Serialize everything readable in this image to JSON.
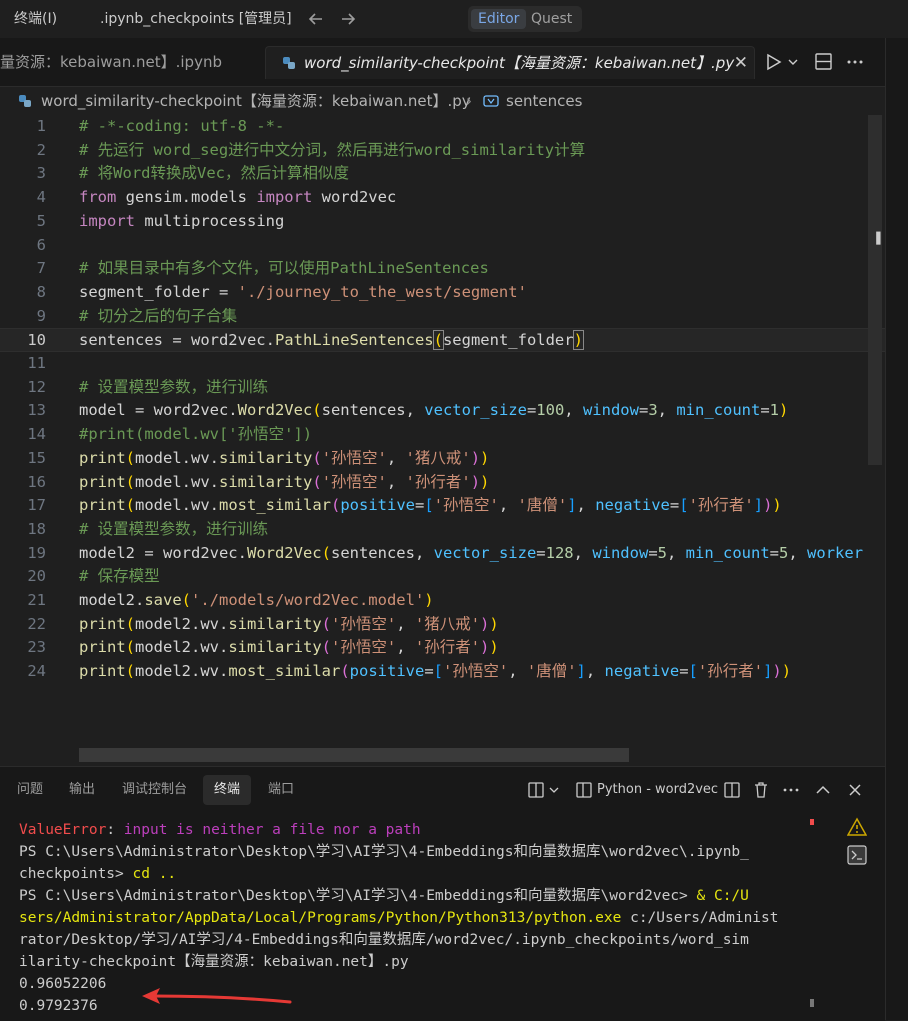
{
  "titlebar": {
    "panel_title": "终端(I)",
    "folder_title": ".ipynb_checkpoints [管理员]",
    "mode_editor": "Editor",
    "mode_quest": "Quest"
  },
  "tabs": {
    "inactive_label": "量资源：kebaiwan.net】.ipynb",
    "active_label": "word_similarity-checkpoint【海量资源：kebaiwan.net】.py",
    "close_glyph": "✕"
  },
  "breadcrumb": {
    "file": "word_similarity-checkpoint【海量资源：kebaiwan.net】.py",
    "separator": "›",
    "symbol": "sentences"
  },
  "editor": {
    "current_line": 10,
    "lines": [
      {
        "n": "1",
        "tokens": [
          {
            "t": "# -*-coding: utf-8 -*-",
            "c": "cm"
          }
        ]
      },
      {
        "n": "2",
        "tokens": [
          {
            "t": "# 先运行 word_seg进行中文分词，然后再进行word_similarity计算",
            "c": "cm"
          }
        ]
      },
      {
        "n": "3",
        "tokens": [
          {
            "t": "# 将Word转换成Vec，然后计算相似度",
            "c": "cm"
          }
        ]
      },
      {
        "n": "4",
        "tokens": [
          {
            "t": "from",
            "c": "kw"
          },
          {
            "t": " gensim.models ",
            "c": "id"
          },
          {
            "t": "import",
            "c": "kw"
          },
          {
            "t": " word2vec",
            "c": "id"
          }
        ]
      },
      {
        "n": "5",
        "tokens": [
          {
            "t": "import",
            "c": "kw"
          },
          {
            "t": " multiprocessing",
            "c": "id"
          }
        ]
      },
      {
        "n": "6",
        "tokens": []
      },
      {
        "n": "7",
        "tokens": [
          {
            "t": "# 如果目录中有多个文件，可以使用PathLineSentences",
            "c": "cm"
          }
        ]
      },
      {
        "n": "8",
        "tokens": [
          {
            "t": "segment_folder = ",
            "c": "id"
          },
          {
            "t": "'./journey_to_the_west/segment'",
            "c": "str"
          }
        ]
      },
      {
        "n": "9",
        "tokens": [
          {
            "t": "# 切分之后的句子合集",
            "c": "cm"
          }
        ]
      },
      {
        "n": "10",
        "tokens": [
          {
            "t": "sentences = word2vec.",
            "c": "id"
          },
          {
            "t": "PathLineSentences",
            "c": "fn"
          },
          {
            "t": "(",
            "c": "br1 br-hl"
          },
          {
            "t": "segment_folder",
            "c": "id"
          },
          {
            "t": ")",
            "c": "br1 br-hl"
          }
        ]
      },
      {
        "n": "11",
        "tokens": []
      },
      {
        "n": "12",
        "tokens": [
          {
            "t": "# 设置模型参数，进行训练",
            "c": "cm"
          }
        ]
      },
      {
        "n": "13",
        "tokens": [
          {
            "t": "model = word2vec.",
            "c": "id"
          },
          {
            "t": "Word2Vec",
            "c": "fn"
          },
          {
            "t": "(",
            "c": "br1"
          },
          {
            "t": "sentences, ",
            "c": "id"
          },
          {
            "t": "vector_size",
            "c": "prm"
          },
          {
            "t": "=",
            "c": "id"
          },
          {
            "t": "100",
            "c": "num"
          },
          {
            "t": ", ",
            "c": "id"
          },
          {
            "t": "window",
            "c": "prm"
          },
          {
            "t": "=",
            "c": "id"
          },
          {
            "t": "3",
            "c": "num"
          },
          {
            "t": ", ",
            "c": "id"
          },
          {
            "t": "min_count",
            "c": "prm"
          },
          {
            "t": "=",
            "c": "id"
          },
          {
            "t": "1",
            "c": "num"
          },
          {
            "t": ")",
            "c": "br1"
          }
        ]
      },
      {
        "n": "14",
        "tokens": [
          {
            "t": "#print(model.wv['孙悟空'])",
            "c": "cm"
          }
        ]
      },
      {
        "n": "15",
        "tokens": [
          {
            "t": "print",
            "c": "fn"
          },
          {
            "t": "(",
            "c": "br1"
          },
          {
            "t": "model.wv.",
            "c": "id"
          },
          {
            "t": "similarity",
            "c": "fn"
          },
          {
            "t": "(",
            "c": "br2"
          },
          {
            "t": "'孙悟空'",
            "c": "str"
          },
          {
            "t": ", ",
            "c": "id"
          },
          {
            "t": "'猪八戒'",
            "c": "str"
          },
          {
            "t": ")",
            "c": "br2"
          },
          {
            "t": ")",
            "c": "br1"
          }
        ]
      },
      {
        "n": "16",
        "tokens": [
          {
            "t": "print",
            "c": "fn"
          },
          {
            "t": "(",
            "c": "br1"
          },
          {
            "t": "model.wv.",
            "c": "id"
          },
          {
            "t": "similarity",
            "c": "fn"
          },
          {
            "t": "(",
            "c": "br2"
          },
          {
            "t": "'孙悟空'",
            "c": "str"
          },
          {
            "t": ", ",
            "c": "id"
          },
          {
            "t": "'孙行者'",
            "c": "str"
          },
          {
            "t": ")",
            "c": "br2"
          },
          {
            "t": ")",
            "c": "br1"
          }
        ]
      },
      {
        "n": "17",
        "tokens": [
          {
            "t": "print",
            "c": "fn"
          },
          {
            "t": "(",
            "c": "br1"
          },
          {
            "t": "model.wv.",
            "c": "id"
          },
          {
            "t": "most_similar",
            "c": "fn"
          },
          {
            "t": "(",
            "c": "br2"
          },
          {
            "t": "positive",
            "c": "prm"
          },
          {
            "t": "=",
            "c": "id"
          },
          {
            "t": "[",
            "c": "br3"
          },
          {
            "t": "'孙悟空'",
            "c": "str"
          },
          {
            "t": ", ",
            "c": "id"
          },
          {
            "t": "'唐僧'",
            "c": "str"
          },
          {
            "t": "]",
            "c": "br3"
          },
          {
            "t": ", ",
            "c": "id"
          },
          {
            "t": "negative",
            "c": "prm"
          },
          {
            "t": "=",
            "c": "id"
          },
          {
            "t": "[",
            "c": "br3"
          },
          {
            "t": "'孙行者'",
            "c": "str"
          },
          {
            "t": "]",
            "c": "br3"
          },
          {
            "t": ")",
            "c": "br2"
          },
          {
            "t": ")",
            "c": "br1"
          }
        ]
      },
      {
        "n": "18",
        "tokens": [
          {
            "t": "# 设置模型参数，进行训练",
            "c": "cm"
          }
        ]
      },
      {
        "n": "19",
        "tokens": [
          {
            "t": "model2 = word2vec.",
            "c": "id"
          },
          {
            "t": "Word2Vec",
            "c": "fn"
          },
          {
            "t": "(",
            "c": "br1"
          },
          {
            "t": "sentences, ",
            "c": "id"
          },
          {
            "t": "vector_size",
            "c": "prm"
          },
          {
            "t": "=",
            "c": "id"
          },
          {
            "t": "128",
            "c": "num"
          },
          {
            "t": ", ",
            "c": "id"
          },
          {
            "t": "window",
            "c": "prm"
          },
          {
            "t": "=",
            "c": "id"
          },
          {
            "t": "5",
            "c": "num"
          },
          {
            "t": ", ",
            "c": "id"
          },
          {
            "t": "min_count",
            "c": "prm"
          },
          {
            "t": "=",
            "c": "id"
          },
          {
            "t": "5",
            "c": "num"
          },
          {
            "t": ", ",
            "c": "id"
          },
          {
            "t": "worker",
            "c": "prm"
          }
        ]
      },
      {
        "n": "20",
        "tokens": [
          {
            "t": "# 保存模型",
            "c": "cm"
          }
        ]
      },
      {
        "n": "21",
        "tokens": [
          {
            "t": "model2.",
            "c": "id"
          },
          {
            "t": "save",
            "c": "fn"
          },
          {
            "t": "(",
            "c": "br1"
          },
          {
            "t": "'./models/word2Vec.model'",
            "c": "str"
          },
          {
            "t": ")",
            "c": "br1"
          }
        ]
      },
      {
        "n": "22",
        "tokens": [
          {
            "t": "print",
            "c": "fn"
          },
          {
            "t": "(",
            "c": "br1"
          },
          {
            "t": "model2.wv.",
            "c": "id"
          },
          {
            "t": "similarity",
            "c": "fn"
          },
          {
            "t": "(",
            "c": "br2"
          },
          {
            "t": "'孙悟空'",
            "c": "str"
          },
          {
            "t": ", ",
            "c": "id"
          },
          {
            "t": "'猪八戒'",
            "c": "str"
          },
          {
            "t": ")",
            "c": "br2"
          },
          {
            "t": ")",
            "c": "br1"
          }
        ]
      },
      {
        "n": "23",
        "tokens": [
          {
            "t": "print",
            "c": "fn"
          },
          {
            "t": "(",
            "c": "br1"
          },
          {
            "t": "model2.wv.",
            "c": "id"
          },
          {
            "t": "similarity",
            "c": "fn"
          },
          {
            "t": "(",
            "c": "br2"
          },
          {
            "t": "'孙悟空'",
            "c": "str"
          },
          {
            "t": ", ",
            "c": "id"
          },
          {
            "t": "'孙行者'",
            "c": "str"
          },
          {
            "t": ")",
            "c": "br2"
          },
          {
            "t": ")",
            "c": "br1"
          }
        ]
      },
      {
        "n": "24",
        "tokens": [
          {
            "t": "print",
            "c": "fn"
          },
          {
            "t": "(",
            "c": "br1"
          },
          {
            "t": "model2.wv.",
            "c": "id"
          },
          {
            "t": "most_similar",
            "c": "fn"
          },
          {
            "t": "(",
            "c": "br2"
          },
          {
            "t": "positive",
            "c": "prm"
          },
          {
            "t": "=",
            "c": "id"
          },
          {
            "t": "[",
            "c": "br3"
          },
          {
            "t": "'孙悟空'",
            "c": "str"
          },
          {
            "t": ", ",
            "c": "id"
          },
          {
            "t": "'唐僧'",
            "c": "str"
          },
          {
            "t": "]",
            "c": "br3"
          },
          {
            "t": ", ",
            "c": "id"
          },
          {
            "t": "negative",
            "c": "prm"
          },
          {
            "t": "=",
            "c": "id"
          },
          {
            "t": "[",
            "c": "br3"
          },
          {
            "t": "'孙行者'",
            "c": "str"
          },
          {
            "t": "]",
            "c": "br3"
          },
          {
            "t": ")",
            "c": "br2"
          },
          {
            "t": ")",
            "c": "br1"
          }
        ]
      }
    ]
  },
  "panel": {
    "tabs": [
      "问题",
      "输出",
      "调试控制台",
      "终端",
      "端口"
    ],
    "active_tab": "终端",
    "terminal_name": "Python - word2vec"
  },
  "terminal": {
    "lines": [
      [
        {
          "t": "ValueError",
          "c": "err"
        },
        {
          "t": ": ",
          "c": ""
        },
        {
          "t": "input is neither a file nor a path",
          "c": "pink"
        }
      ],
      [
        {
          "t": "PS C:\\Users\\Administrator\\Desktop\\学习\\AI学习\\4-Embeddings和向量数据库\\word2vec\\.ipynb_",
          "c": ""
        }
      ],
      [
        {
          "t": "checkpoints> ",
          "c": ""
        },
        {
          "t": "cd ..",
          "c": "yel"
        }
      ],
      [
        {
          "t": "PS C:\\Users\\Administrator\\Desktop\\学习\\AI学习\\4-Embeddings和向量数据库\\word2vec> ",
          "c": ""
        },
        {
          "t": "& C:/U",
          "c": "yel"
        }
      ],
      [
        {
          "t": "sers/Administrator/AppData/Local/Programs/Python/Python313/python.exe",
          "c": "yel"
        },
        {
          "t": " c:/Users/Administ",
          "c": ""
        }
      ],
      [
        {
          "t": "rator/Desktop/学习/AI学习/4-Embeddings和向量数据库/word2vec/.ipynb_checkpoints/word_sim",
          "c": ""
        }
      ],
      [
        {
          "t": "ilarity-checkpoint【海量资源：kebaiwan.net】.py",
          "c": ""
        }
      ],
      [
        {
          "t": "0.96052206",
          "c": ""
        }
      ],
      [
        {
          "t": "0.9792376",
          "c": ""
        }
      ]
    ]
  },
  "colors": {
    "background": "#1f1f1f",
    "accent": "#7aa7e6",
    "annotation_arrow": "#e53935"
  }
}
